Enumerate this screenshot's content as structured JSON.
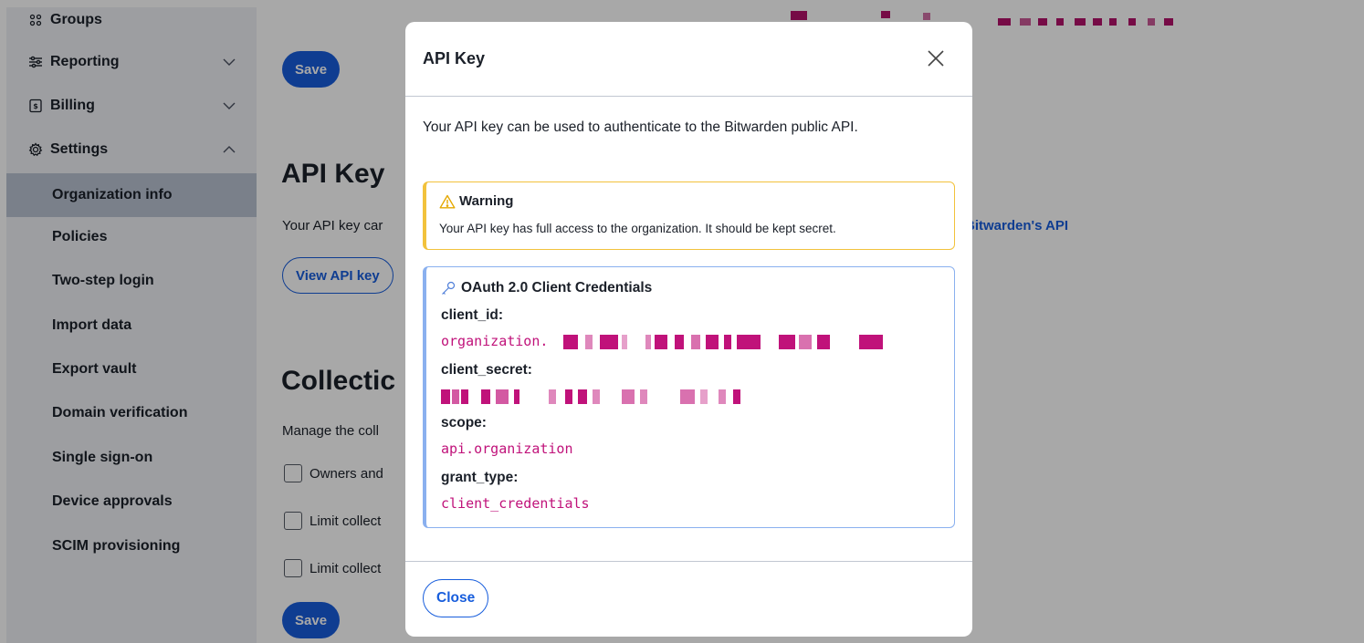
{
  "sidebar": {
    "top_items": [
      {
        "label": "Groups",
        "icon": "groups-icon"
      },
      {
        "label": "Reporting",
        "icon": "sliders-icon",
        "expanded": false
      },
      {
        "label": "Billing",
        "icon": "billing-icon",
        "expanded": false
      },
      {
        "label": "Settings",
        "icon": "gear-icon",
        "expanded": true
      }
    ],
    "settings_items": [
      {
        "label": "Organization info",
        "active": true
      },
      {
        "label": "Policies"
      },
      {
        "label": "Two-step login"
      },
      {
        "label": "Import data"
      },
      {
        "label": "Export vault"
      },
      {
        "label": "Domain verification"
      },
      {
        "label": "Single sign-on"
      },
      {
        "label": "Device approvals"
      },
      {
        "label": "SCIM provisioning"
      }
    ]
  },
  "main": {
    "save_label": "Save",
    "api_section": {
      "title": "API Key",
      "description": "Your API key car",
      "link": "Bitwarden's API",
      "view_button": "View API key"
    },
    "collection_section": {
      "title": "Collectic",
      "description": "Manage the coll",
      "options": [
        "Owners and",
        "Limit collect",
        "Limit collect"
      ]
    }
  },
  "dialog": {
    "title": "API Key",
    "description": "Your API key can be used to authenticate to the Bitwarden public API.",
    "warning": {
      "title": "Warning",
      "text": "Your API key has full access to the organization. It should be kept secret."
    },
    "credentials": {
      "title": "OAuth 2.0 Client Credentials",
      "client_id_label": "client_id:",
      "client_id_prefix": "organization.",
      "client_secret_label": "client_secret:",
      "scope_label": "scope:",
      "scope_value": "api.organization",
      "grant_type_label": "grant_type:",
      "grant_type_value": "client_credentials"
    },
    "close_label": "Close"
  },
  "colors": {
    "primary": "#175ddc",
    "secret_text": "#c0127a",
    "warning_border": "#f2c23c",
    "info_border": "#8ab0ef",
    "sidebar_bg": "#eef0f4",
    "sidebar_active": "#b9c2d2"
  }
}
